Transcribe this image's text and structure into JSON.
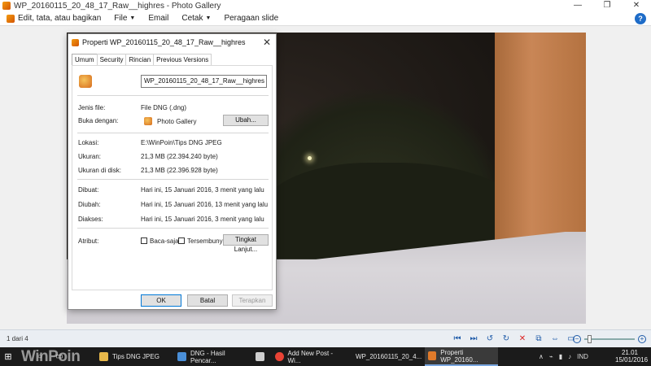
{
  "window": {
    "title": "WP_20160115_20_48_17_Raw__highres - Photo Gallery",
    "controls": [
      "—",
      "❐",
      "✕"
    ]
  },
  "menubar": {
    "edit": "Edit, tata, atau bagikan",
    "file": "File",
    "email": "Email",
    "print": "Cetak",
    "slideshow": "Peragaan slide",
    "help": "?"
  },
  "dialog": {
    "title": "Properti WP_20160115_20_48_17_Raw__highres",
    "tabs": [
      "Umum",
      "Security",
      "Rincian",
      "Previous Versions"
    ],
    "filename": "WP_20160115_20_48_17_Raw__highres",
    "fields": {
      "type_label": "Jenis file:",
      "type_value": "File DNG (.dng)",
      "opens_label": "Buka dengan:",
      "opens_value": "Photo Gallery",
      "change_button": "Ubah...",
      "location_label": "Lokasi:",
      "location_value": "E:\\WinPoin\\Tips DNG JPEG",
      "size_label": "Ukuran:",
      "size_value": "21,3 MB (22.394.240 byte)",
      "disk_label": "Ukuran di disk:",
      "disk_value": "21,3 MB (22.396.928 byte)",
      "created_label": "Dibuat:",
      "created_value": "Hari ini, 15 Januari 2016, 3 menit yang lalu",
      "modified_label": "Diubah:",
      "modified_value": "Hari ini, 15 Januari 2016, 13 menit yang lalu",
      "accessed_label": "Diakses:",
      "accessed_value": "Hari ini, 15 Januari 2016, 3 menit yang lalu",
      "attributes_label": "Atribut:",
      "readonly_label": "Baca-saja",
      "hidden_label": "Tersembunyi",
      "advanced_button": "Tingkat Lanjut..."
    },
    "buttons": {
      "ok": "OK",
      "cancel": "Batal",
      "apply": "Terapkan"
    }
  },
  "statusbar": {
    "page": "1 dari 4"
  },
  "taskbar": {
    "watermark": "WinPoin",
    "items": [
      {
        "label": "Tips DNG JPEG",
        "color": "#e8b84a"
      },
      {
        "label": "DNG - Hasil Pencar...",
        "color": "#4a8fd8"
      },
      {
        "label": "",
        "color": "#cfcfcf"
      },
      {
        "label": "Add New Post - Wi...",
        "color": "#e94335"
      },
      {
        "label": "WP_20160115_20_4...",
        "color": "#e07a2a"
      },
      {
        "label": "Properti WP_20160...",
        "color": "#e07a2a"
      }
    ],
    "tray_lang": "IND",
    "time": "21.01",
    "date": "15/01/2016"
  }
}
